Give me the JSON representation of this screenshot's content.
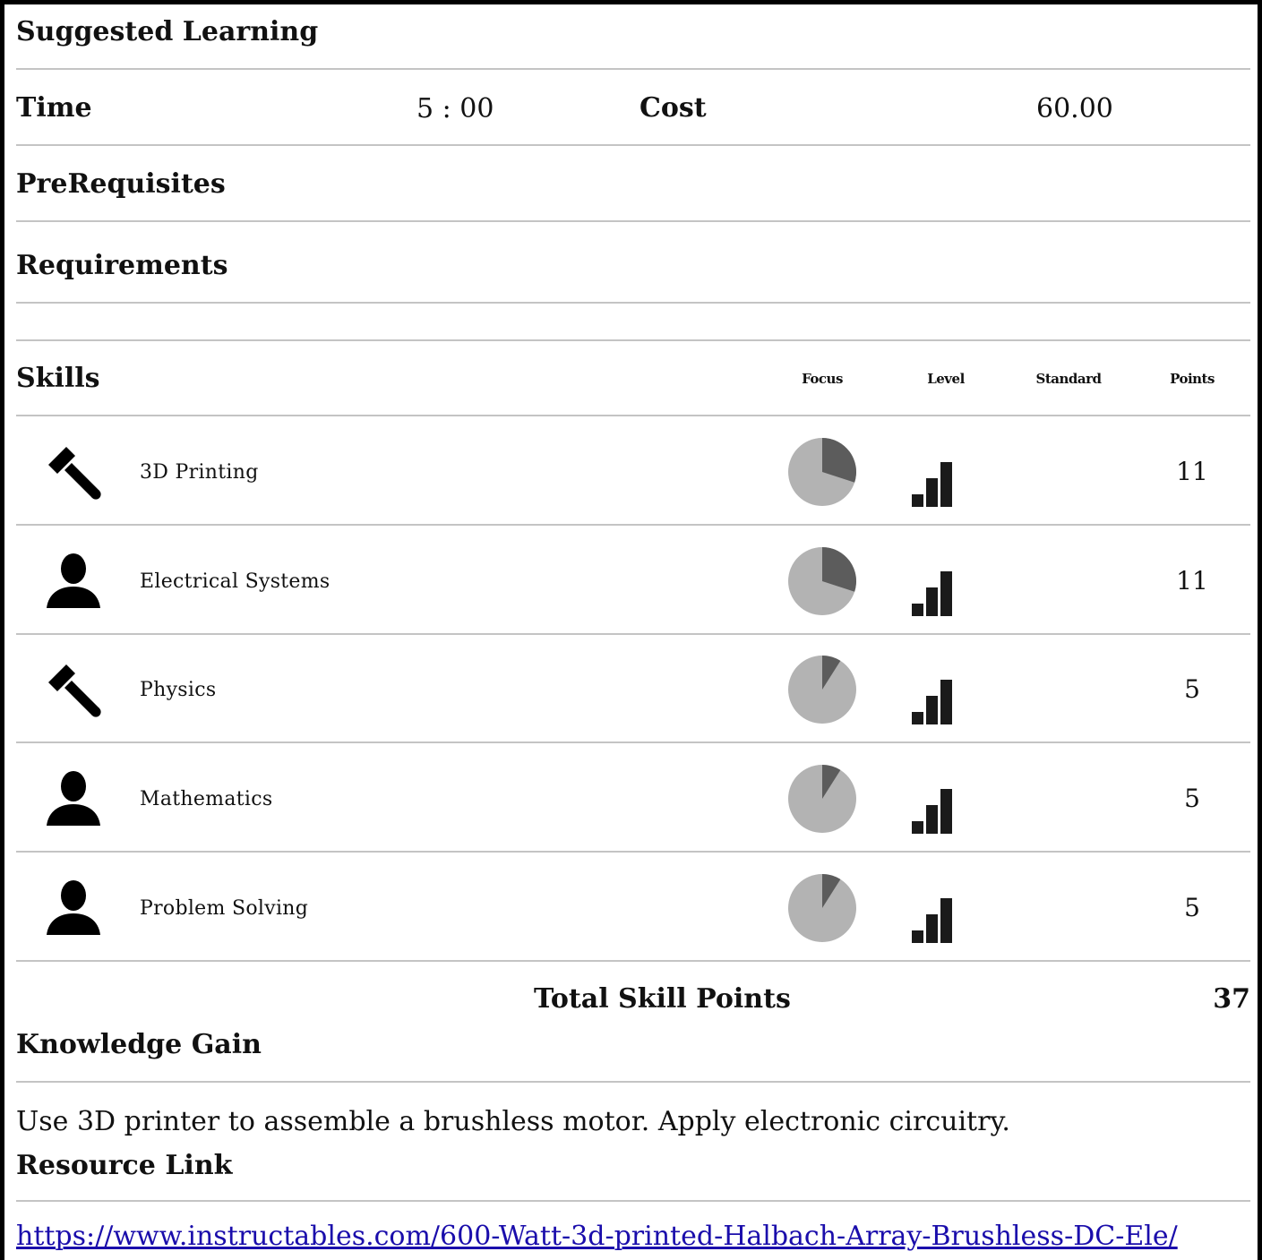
{
  "header": {
    "title": "Suggested Learning"
  },
  "time": {
    "label": "Time",
    "value": "5 : 00"
  },
  "cost": {
    "label": "Cost",
    "value": "60.00"
  },
  "prerequisites": {
    "label": "PreRequisites"
  },
  "requirements": {
    "label": "Requirements"
  },
  "skills": {
    "label": "Skills",
    "columns": {
      "focus": "Focus",
      "level": "Level",
      "standard": "Standard",
      "points": "Points"
    },
    "items": [
      {
        "icon": "hammer-icon",
        "name": "3D Printing",
        "focus": 0.3,
        "level": 3,
        "points": "11"
      },
      {
        "icon": "person-icon",
        "name": "Electrical Systems",
        "focus": 0.3,
        "level": 3,
        "points": "11"
      },
      {
        "icon": "hammer-icon",
        "name": "Physics",
        "focus": 0.09,
        "level": 3,
        "points": "5"
      },
      {
        "icon": "person-icon",
        "name": "Mathematics",
        "focus": 0.09,
        "level": 3,
        "points": "5"
      },
      {
        "icon": "person-icon",
        "name": "Problem Solving",
        "focus": 0.09,
        "level": 3,
        "points": "5"
      }
    ],
    "total_label": "Total Skill Points",
    "total_value": "37"
  },
  "knowledge": {
    "label": "Knowledge Gain",
    "text": "Use 3D printer to assemble a brushless motor. Apply electronic circuitry."
  },
  "resource": {
    "label": "Resource Link",
    "url": "https://www.instructables.com/600-Watt-3d-printed-Halbach-Array-Brushless-DC-Ele/"
  },
  "colors": {
    "pie_light": "#b3b3b3",
    "pie_dark": "#5c5c5c",
    "bar": "#1a1a1a",
    "rule": "#c4c4c4"
  }
}
